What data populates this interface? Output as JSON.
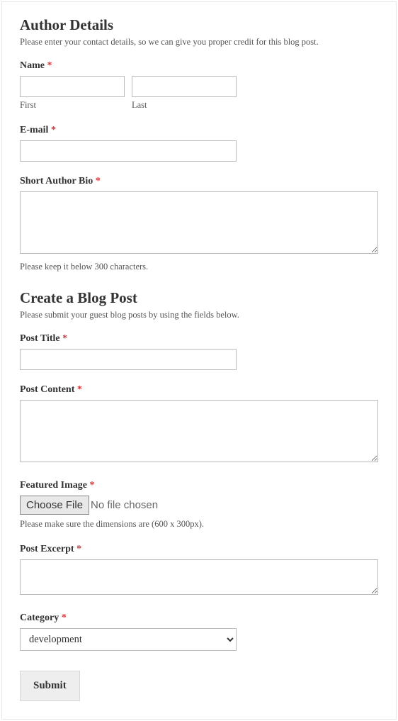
{
  "section1": {
    "heading": "Author Details",
    "desc": "Please enter your contact details, so we can give you proper credit for this blog post."
  },
  "name": {
    "label": "Name",
    "first_sub": "First",
    "last_sub": "Last"
  },
  "email": {
    "label": "E-mail"
  },
  "bio": {
    "label": "Short Author Bio",
    "help": "Please keep it below 300 characters."
  },
  "section2": {
    "heading": "Create a Blog Post",
    "desc": "Please submit your guest blog posts by using the fields below."
  },
  "title": {
    "label": "Post Title"
  },
  "content": {
    "label": "Post Content"
  },
  "image": {
    "label": "Featured Image",
    "button": "Choose File",
    "status": "No file chosen",
    "help": "Please make sure the dimensions are (600 x 300px)."
  },
  "excerpt": {
    "label": "Post Excerpt"
  },
  "category": {
    "label": "Category",
    "selected": "development"
  },
  "submit": {
    "label": "Submit"
  },
  "required_mark": "*"
}
